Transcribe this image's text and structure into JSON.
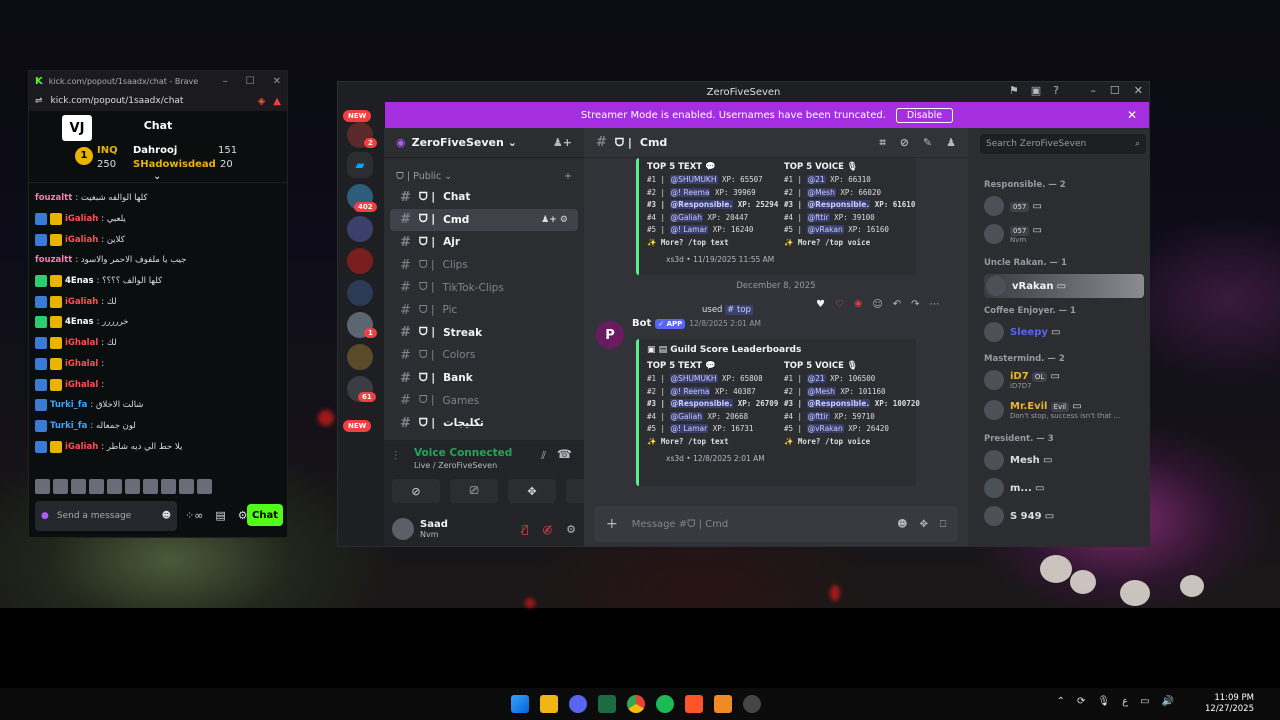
{
  "kick": {
    "window_title": "kick.com/popout/1saadx/chat - Brave",
    "url": "kick.com/popout/1saadx/chat",
    "logo": "VJ",
    "chat_title": "Chat",
    "leaderboard": {
      "rank": "1",
      "top_left_user": "INQ",
      "top_left_value": "250",
      "entries": [
        {
          "name": "Dahrooj",
          "value": "151"
        },
        {
          "name": "SHadowisdead",
          "value": "20"
        }
      ]
    },
    "messages": [
      {
        "user": "fouzaltt",
        "text": ": كلها الوالفه شبغيت",
        "color": "#ff77b4",
        "badges": []
      },
      {
        "user": "iGaliah",
        "text": ": يلعبي",
        "color": "#ff4f4f",
        "badges": [
          "blue",
          "gold"
        ]
      },
      {
        "user": "iGaliah",
        "text": ": كلاين",
        "color": "#ff4f4f",
        "badges": [
          "blue",
          "gold"
        ]
      },
      {
        "user": "fouzaltt",
        "text": ": جيب يا ملفوف الاحمر والاسود",
        "color": "#ff77b4",
        "badges": []
      },
      {
        "user": "4Enas",
        "text": ": كلها الوالف ؟؟؟؟",
        "color": "#ffffff",
        "badges": [
          "green",
          "gold"
        ]
      },
      {
        "user": "iGaliah",
        "text": ": لك",
        "color": "#ff4f4f",
        "badges": [
          "blue",
          "gold"
        ]
      },
      {
        "user": "4Enas",
        "text": ": خررررر",
        "color": "#ffffff",
        "badges": [
          "green",
          "gold"
        ]
      },
      {
        "user": "iGhalal",
        "text": ": لك",
        "color": "#ff4f4f",
        "badges": [
          "blue",
          "gold"
        ]
      },
      {
        "user": "iGhalal",
        "text": ":",
        "color": "#ff4f4f",
        "badges": [
          "blue",
          "gold"
        ]
      },
      {
        "user": "iGhalal",
        "text": ":",
        "color": "#ff4f4f",
        "badges": [
          "blue",
          "gold"
        ]
      },
      {
        "user": "Turki_fa",
        "text": ": شالت الاخلاق",
        "color": "#3ea6ff",
        "badges": [
          "blue"
        ]
      },
      {
        "user": "Turki_fa",
        "text": ": لون جمعاله",
        "color": "#3ea6ff",
        "badges": [
          "blue"
        ]
      },
      {
        "user": "iGaliah",
        "text": ": يلا حط الي ديه شاطر",
        "color": "#ff4f4f",
        "badges": [
          "blue",
          "gold"
        ]
      }
    ],
    "input_placeholder": "Send a message",
    "chat_button": "Chat"
  },
  "discord": {
    "window_title": "ZeroFiveSeven",
    "banner_text": "Streamer Mode is enabled. Usernames have been truncated.",
    "banner_button": "Disable",
    "new_label": "NEW",
    "guild_badges": [
      "2",
      "402",
      "1",
      "61"
    ],
    "server_name": "ZeroFiveSeven",
    "category": "Public",
    "channels": [
      {
        "name": "Chat",
        "bold": true,
        "active": false
      },
      {
        "name": "Cmd",
        "bold": true,
        "active": true
      },
      {
        "name": "Ajr",
        "bold": true,
        "active": false
      },
      {
        "name": "Clips",
        "bold": false,
        "active": false
      },
      {
        "name": "TikTok-Clips",
        "bold": false,
        "active": false
      },
      {
        "name": "Pic",
        "bold": false,
        "active": false
      },
      {
        "name": "Streak",
        "bold": true,
        "active": false
      },
      {
        "name": "Colors",
        "bold": false,
        "active": false
      },
      {
        "name": "Bank",
        "bold": true,
        "active": false
      },
      {
        "name": "Games",
        "bold": false,
        "active": false
      },
      {
        "name": "تكليجات",
        "bold": true,
        "active": false
      }
    ],
    "voice": {
      "status": "Voice Connected",
      "sub": "Live / ZeroFiveSeven"
    },
    "user": {
      "name": "Saad",
      "status": "Nvm"
    },
    "channel_header": "Cmd",
    "embed1": {
      "text_title": "TOP 5 TEXT",
      "voice_title": "TOP 5 VOICE",
      "text_rows": [
        {
          "rank": "#1",
          "user": "@SHUMUKH",
          "xp": "65507"
        },
        {
          "rank": "#2",
          "user": "@! Reema",
          "xp": "39969"
        },
        {
          "rank": "#3",
          "user": "@Responsible.",
          "xp": "25294"
        },
        {
          "rank": "#4",
          "user": "@Galiah",
          "xp": "20447"
        },
        {
          "rank": "#5",
          "user": "@! Lamar",
          "xp": "16240"
        }
      ],
      "voice_rows": [
        {
          "rank": "#1",
          "user": "@21",
          "xp": "66310"
        },
        {
          "rank": "#2",
          "user": "@Mesh",
          "xp": "66020"
        },
        {
          "rank": "#3",
          "user": "@Responsible.",
          "xp": "61610"
        },
        {
          "rank": "#4",
          "user": "@fttir",
          "xp": "39100"
        },
        {
          "rank": "#5",
          "user": "@vRakan",
          "xp": "16160"
        }
      ],
      "more_text": "More? /top text",
      "more_voice": "More? /top voice",
      "footer": "xs3d • 11/19/2025 11:55 AM"
    },
    "date_divider": "December 8, 2025",
    "used_prefix": "used",
    "used_cmd": "# top",
    "bot_name": "Bot",
    "bot_app": "✓ APP",
    "bot_time": "12/8/2025 2:01 AM",
    "embed2": {
      "title": "Guild Score Leaderboards",
      "text_title": "TOP 5 TEXT",
      "voice_title": "TOP 5 VOICE",
      "text_rows": [
        {
          "rank": "#1",
          "user": "@SHUMUKH",
          "xp": "65808"
        },
        {
          "rank": "#2",
          "user": "@! Reema",
          "xp": "40387"
        },
        {
          "rank": "#3",
          "user": "@Responsible.",
          "xp": "26709"
        },
        {
          "rank": "#4",
          "user": "@Galiah",
          "xp": "20668"
        },
        {
          "rank": "#5",
          "user": "@! Lamar",
          "xp": "16731"
        }
      ],
      "voice_rows": [
        {
          "rank": "#1",
          "user": "@21",
          "xp": "106500"
        },
        {
          "rank": "#2",
          "user": "@Mesh",
          "xp": "101160"
        },
        {
          "rank": "#3",
          "user": "@Responsible.",
          "xp": "100720"
        },
        {
          "rank": "#4",
          "user": "@fttir",
          "xp": "59710"
        },
        {
          "rank": "#5",
          "user": "@vRakan",
          "xp": "26420"
        }
      ],
      "more_text": "More? /top text",
      "more_voice": "More? /top voice",
      "footer": "xs3d • 12/8/2025 2:01 AM"
    },
    "composer_placeholder": "Message #ᗜ | Cmd",
    "member_search": "Search ZeroFiveSeven",
    "member_groups": [
      {
        "role": "Responsible. — 2",
        "members": [
          {
            "name": "",
            "tag": "057",
            "sub": ""
          },
          {
            "name": "",
            "tag": "057",
            "sub": "Nvm"
          }
        ]
      },
      {
        "role": "Uncle Rakan. — 1",
        "members": [
          {
            "name": "vRakan",
            "tag": "",
            "sub": ""
          }
        ]
      },
      {
        "role": "Coffee Enjoyer. — 1",
        "members": [
          {
            "name": "Sleepy",
            "tag": "",
            "sub": ""
          }
        ]
      },
      {
        "role": "Mastermind. — 2",
        "members": [
          {
            "name": "iD7",
            "tag": "OL",
            "sub": "iD7D7"
          },
          {
            "name": "Mr.Evil",
            "tag": "Evil",
            "sub": "Don't stop, success isn't that ..."
          }
        ]
      },
      {
        "role": "President. — 3",
        "members": [
          {
            "name": "Mesh",
            "tag": "",
            "sub": ""
          },
          {
            "name": "m...",
            "tag": "",
            "sub": ""
          },
          {
            "name": "S 949",
            "tag": "",
            "sub": ""
          }
        ]
      }
    ]
  },
  "taskbar": {
    "tray_lang": "ع",
    "time": "11:09 PM",
    "date": "12/27/2025"
  }
}
